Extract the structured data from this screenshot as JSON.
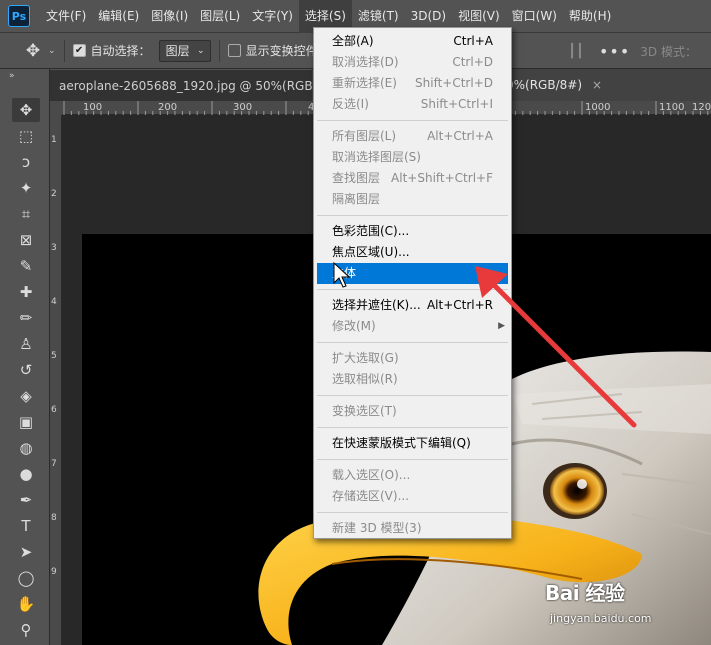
{
  "app": {
    "logo": "Ps",
    "menu": [
      "文件(F)",
      "编辑(E)",
      "图像(I)",
      "图层(L)",
      "文字(Y)",
      "选择(S)",
      "滤镜(T)",
      "3D(D)",
      "视图(V)",
      "窗口(W)",
      "帮助(H)"
    ],
    "active_menu_index": 5
  },
  "options": {
    "auto_select_label": "自动选择：",
    "auto_select_checked": true,
    "target_value": "图层",
    "show_transform_label": "显示变换控件",
    "mode_label": "3D 模式：",
    "more_label": "•••"
  },
  "document": {
    "tab_title": "aeroplane-2605688_1920.jpg @ 50%(RGB/8#)",
    "tab2_title": "0%(RGB/8#)",
    "close_label": "×"
  },
  "rulers": {
    "top": [
      "100",
      "200",
      "300",
      "400",
      "1000",
      "1100",
      "1200"
    ],
    "left": [
      "1",
      "2",
      "3",
      "4",
      "5",
      "6",
      "7",
      "8",
      "9"
    ]
  },
  "select_menu": {
    "groups": [
      [
        {
          "label": "全部(A)",
          "shortcut": "Ctrl+A",
          "disabled": false
        },
        {
          "label": "取消选择(D)",
          "shortcut": "Ctrl+D",
          "disabled": true
        },
        {
          "label": "重新选择(E)",
          "shortcut": "Shift+Ctrl+D",
          "disabled": true
        },
        {
          "label": "反选(I)",
          "shortcut": "Shift+Ctrl+I",
          "disabled": true
        }
      ],
      [
        {
          "label": "所有图层(L)",
          "shortcut": "Alt+Ctrl+A",
          "disabled": true
        },
        {
          "label": "取消选择图层(S)",
          "shortcut": "",
          "disabled": true
        },
        {
          "label": "查找图层",
          "shortcut": "Alt+Shift+Ctrl+F",
          "disabled": true
        },
        {
          "label": "隔离图层",
          "shortcut": "",
          "disabled": true
        }
      ],
      [
        {
          "label": "色彩范围(C)...",
          "shortcut": "",
          "disabled": false
        },
        {
          "label": "焦点区域(U)...",
          "shortcut": "",
          "disabled": false
        },
        {
          "label": "主体",
          "shortcut": "",
          "disabled": false,
          "highlighted": true
        }
      ],
      [
        {
          "label": "选择并遮住(K)...",
          "shortcut": "Alt+Ctrl+R",
          "disabled": false
        },
        {
          "label": "修改(M)",
          "shortcut": "",
          "disabled": true,
          "submenu": true
        }
      ],
      [
        {
          "label": "扩大选取(G)",
          "shortcut": "",
          "disabled": true
        },
        {
          "label": "选取相似(R)",
          "shortcut": "",
          "disabled": true
        }
      ],
      [
        {
          "label": "变换选区(T)",
          "shortcut": "",
          "disabled": true
        }
      ],
      [
        {
          "label": "在快速蒙版模式下编辑(Q)",
          "shortcut": "",
          "disabled": false
        }
      ],
      [
        {
          "label": "载入选区(O)...",
          "shortcut": "",
          "disabled": true
        },
        {
          "label": "存储选区(V)...",
          "shortcut": "",
          "disabled": true
        }
      ],
      [
        {
          "label": "新建 3D 模型(3)",
          "shortcut": "",
          "disabled": true
        }
      ]
    ]
  },
  "tools": [
    {
      "name": "move-tool-icon",
      "glyph": "✥",
      "active": true
    },
    {
      "name": "marquee-tool-icon",
      "glyph": "⬚"
    },
    {
      "name": "lasso-tool-icon",
      "glyph": "ↄ"
    },
    {
      "name": "magic-wand-tool-icon",
      "glyph": "✦"
    },
    {
      "name": "crop-tool-icon",
      "glyph": "⌗"
    },
    {
      "name": "frame-tool-icon",
      "glyph": "⊠"
    },
    {
      "name": "eyedropper-tool-icon",
      "glyph": "✎"
    },
    {
      "name": "healing-brush-tool-icon",
      "glyph": "✚"
    },
    {
      "name": "brush-tool-icon",
      "glyph": "✏"
    },
    {
      "name": "clone-stamp-tool-icon",
      "glyph": "♙"
    },
    {
      "name": "history-brush-tool-icon",
      "glyph": "↺"
    },
    {
      "name": "eraser-tool-icon",
      "glyph": "◈"
    },
    {
      "name": "gradient-tool-icon",
      "glyph": "▣"
    },
    {
      "name": "blur-tool-icon",
      "glyph": "◍"
    },
    {
      "name": "dodge-tool-icon",
      "glyph": "●"
    },
    {
      "name": "pen-tool-icon",
      "glyph": "✒"
    },
    {
      "name": "type-tool-icon",
      "glyph": "T"
    },
    {
      "name": "path-selection-tool-icon",
      "glyph": "➤"
    },
    {
      "name": "shape-tool-icon",
      "glyph": "◯"
    },
    {
      "name": "hand-tool-icon",
      "glyph": "✋"
    },
    {
      "name": "zoom-tool-icon",
      "glyph": "⚲"
    }
  ],
  "watermark": {
    "logo": "Bai 经验",
    "url": "jingyan.baidu.com"
  }
}
